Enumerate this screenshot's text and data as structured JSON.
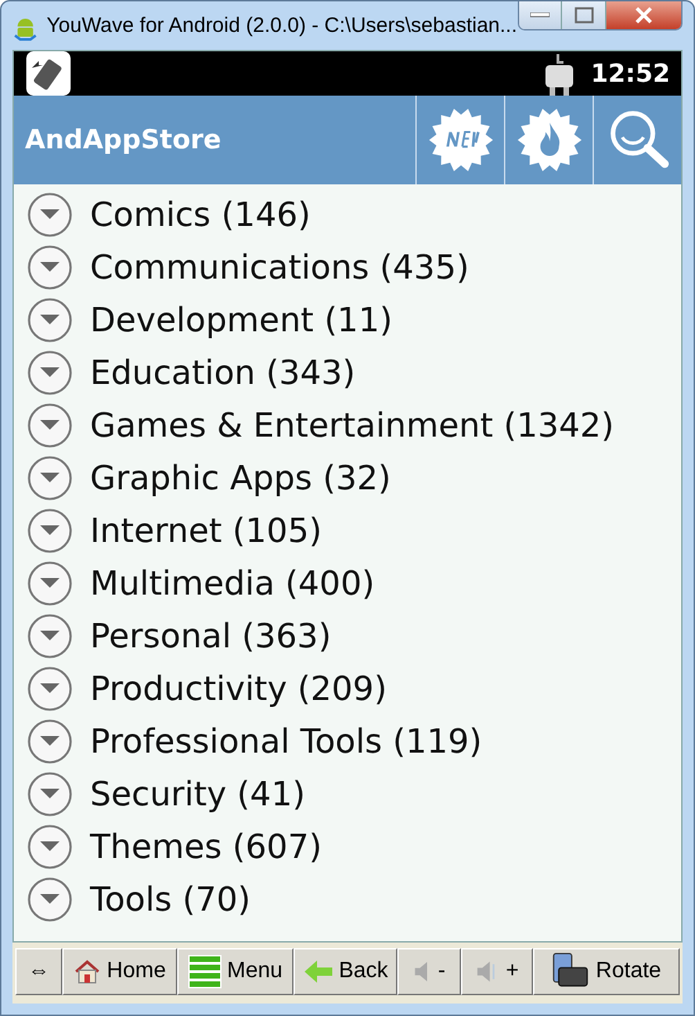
{
  "window": {
    "title": "YouWave for Android (2.0.0) - C:\\Users\\sebastian..."
  },
  "status_bar": {
    "time": "12:52"
  },
  "app_bar": {
    "title": "AndAppStore"
  },
  "categories": [
    {
      "label": "Comics (146)"
    },
    {
      "label": "Communications (435)"
    },
    {
      "label": "Development (11)"
    },
    {
      "label": "Education (343)"
    },
    {
      "label": "Games & Entertainment (1342)"
    },
    {
      "label": "Graphic Apps (32)"
    },
    {
      "label": "Internet (105)"
    },
    {
      "label": "Multimedia (400)"
    },
    {
      "label": "Personal (363)"
    },
    {
      "label": "Productivity (209)"
    },
    {
      "label": "Professional Tools (119)"
    },
    {
      "label": "Security (41)"
    },
    {
      "label": "Themes (607)"
    },
    {
      "label": "Tools (70)"
    }
  ],
  "toolbar": [
    {
      "kind": "resize",
      "label": "⇔"
    },
    {
      "kind": "home",
      "label": "Home"
    },
    {
      "kind": "menu",
      "label": "Menu"
    },
    {
      "kind": "back",
      "label": "Back"
    },
    {
      "kind": "voldown",
      "label": "-"
    },
    {
      "kind": "volup",
      "label": "+"
    },
    {
      "kind": "rotate",
      "label": "Rotate"
    }
  ]
}
